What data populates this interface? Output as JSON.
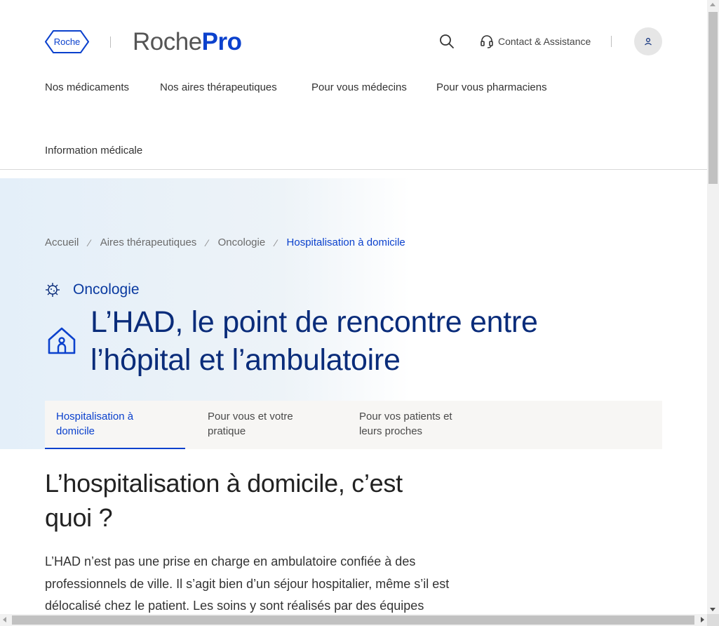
{
  "header": {
    "logo_text": "Roche",
    "brand_part1": "Roche",
    "brand_part2": "Pro",
    "search_icon": "search-icon",
    "contact_icon": "headset-icon",
    "contact_label": "Contact & Assistance",
    "account_icon": "user-icon"
  },
  "nav": {
    "items": [
      {
        "label": "Nos médicaments"
      },
      {
        "label": "Nos aires thérapeutiques"
      },
      {
        "label": "Pour vous médecins"
      },
      {
        "label": "Pour vous pharmaciens"
      },
      {
        "label": "Information médicale"
      }
    ]
  },
  "breadcrumb": {
    "items": [
      {
        "label": "Accueil"
      },
      {
        "label": "Aires thérapeutiques"
      },
      {
        "label": "Oncologie"
      },
      {
        "label": "Hospitalisation à domicile"
      }
    ],
    "separator": "⁄"
  },
  "hero": {
    "category_icon": "virus-icon",
    "category": "Oncologie",
    "title_icon": "home-icon",
    "title": "L’HAD, le point de rencontre entre l’hôpital et l’ambulatoire"
  },
  "tabs": {
    "items": [
      {
        "label": "Hospitalisation à domicile",
        "active": true
      },
      {
        "label": "Pour vous et votre pratique",
        "active": false
      },
      {
        "label": "Pour vos patients et leurs proches",
        "active": false
      }
    ]
  },
  "content": {
    "heading": "L’hospitalisation à domicile, c’est quoi ?",
    "paragraph": "L’HAD n’est pas une prise en charge en ambulatoire confiée à des professionnels de ville. Il s’agit bien d’un séjour hospitalier, même s’il est délocalisé chez le patient. Les soins y sont réalisés par des équipes"
  },
  "colors": {
    "brand_blue": "#0b41cd",
    "title_navy": "#0a2c7a",
    "tabs_bg": "#f7f6f4",
    "hero_gradient_start": "#e4eff9"
  }
}
